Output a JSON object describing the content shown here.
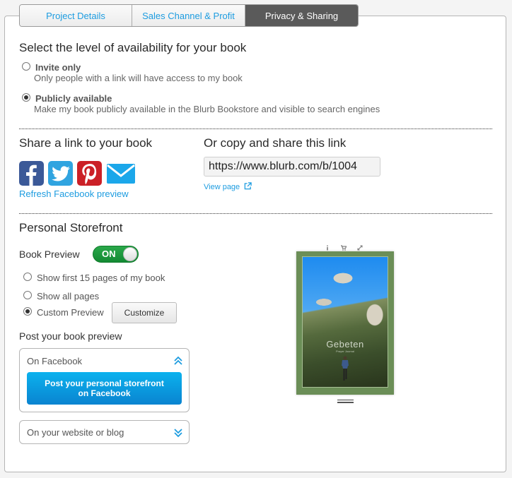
{
  "tabs": [
    {
      "label": "Project Details",
      "active": false
    },
    {
      "label": "Sales Channel & Profit",
      "active": false
    },
    {
      "label": "Privacy & Sharing",
      "active": true
    }
  ],
  "availability": {
    "title": "Select the level of availability for your book",
    "options": [
      {
        "label": "Invite only",
        "description": "Only people with a link will have access to my book",
        "selected": false
      },
      {
        "label": "Publicly available",
        "description": "Make my book publicly available in the Blurb Bookstore and visible to search engines",
        "selected": true
      }
    ]
  },
  "share": {
    "title": "Share a link to your book",
    "icons": [
      "facebook-icon",
      "twitter-icon",
      "pinterest-icon",
      "email-icon"
    ],
    "refresh_label": "Refresh Facebook preview",
    "copy_title": "Or copy and share this link",
    "url": "https://www.blurb.com/b/1004",
    "view_page_label": "View page"
  },
  "storefront": {
    "title": "Personal Storefront",
    "book_preview_label": "Book Preview",
    "toggle_label": "ON",
    "toggle_on": true,
    "preview_options": [
      {
        "label": "Show first 15 pages of my book",
        "selected": false
      },
      {
        "label": "Show all pages",
        "selected": false
      },
      {
        "label": "Custom Preview",
        "selected": true
      }
    ],
    "customize_label": "Customize",
    "post_title": "Post your book preview",
    "facebook_section": {
      "label": "On Facebook",
      "expanded": true,
      "button_line1": "Post your personal storefront",
      "button_line2": "on Facebook"
    },
    "website_section": {
      "label": "On your website or blog",
      "expanded": false
    }
  },
  "book_preview": {
    "title": "Gebeten",
    "subtitle": "Prayer Journal",
    "tools": [
      "info-icon",
      "cart-icon",
      "expand-icon"
    ]
  },
  "colors": {
    "accent": "#1d9ce0",
    "toggle_on": "#1e9a3e",
    "facebook": "#3b5998",
    "twitter": "#30a4e0",
    "pinterest": "#cb2027",
    "email": "#1ba7ea",
    "book_border": "#6b8e57"
  }
}
